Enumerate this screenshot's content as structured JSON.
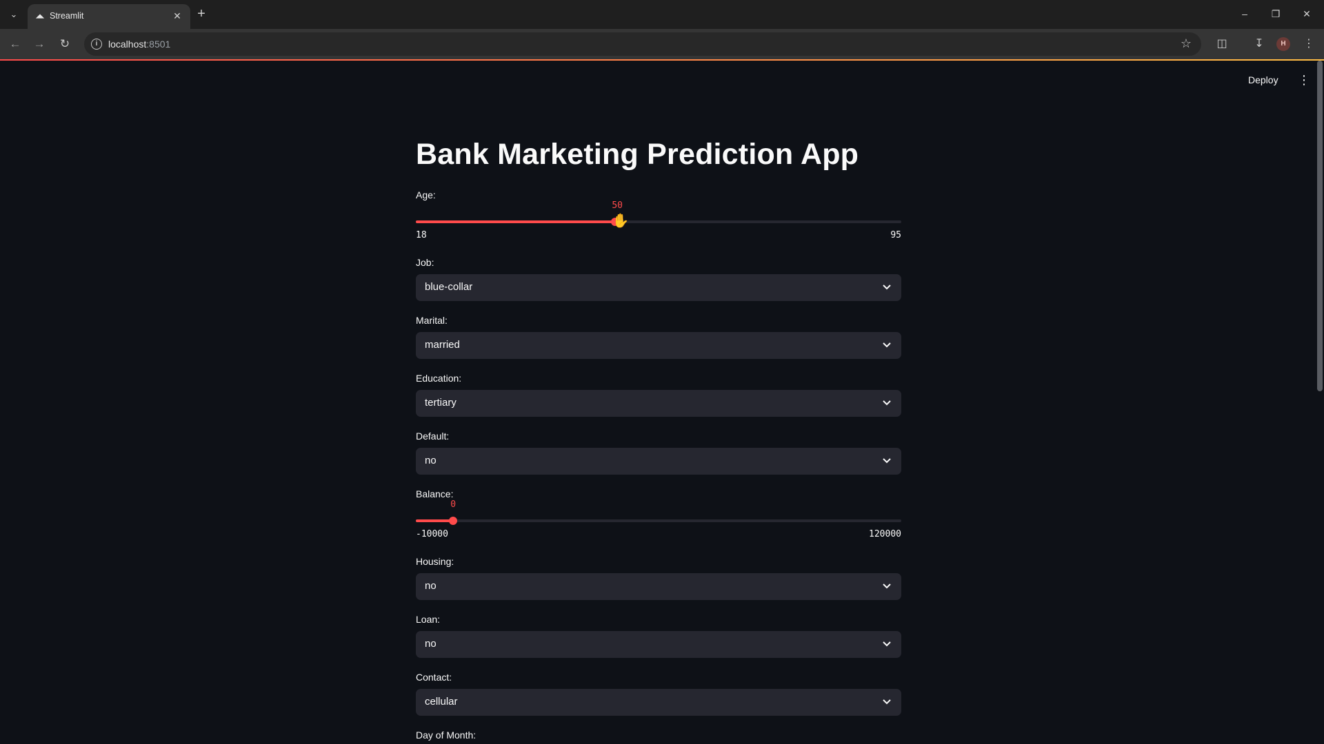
{
  "browser": {
    "tab_title": "Streamlit",
    "url_host": "localhost",
    "url_port": ":8501",
    "avatar_letter": "H"
  },
  "app": {
    "deploy_label": "Deploy",
    "title": "Bank Marketing Prediction App",
    "fields": {
      "age": {
        "label": "Age:",
        "value": "50",
        "min": "18",
        "max": "95"
      },
      "job": {
        "label": "Job:",
        "value": "blue-collar"
      },
      "marital": {
        "label": "Marital:",
        "value": "married"
      },
      "education": {
        "label": "Education:",
        "value": "tertiary"
      },
      "default": {
        "label": "Default:",
        "value": "no"
      },
      "balance": {
        "label": "Balance:",
        "value": "0",
        "min": "-10000",
        "max": "120000"
      },
      "housing": {
        "label": "Housing:",
        "value": "no"
      },
      "loan": {
        "label": "Loan:",
        "value": "no"
      },
      "contact": {
        "label": "Contact:",
        "value": "cellular"
      },
      "day_of_month": {
        "label": "Day of Month:"
      }
    }
  },
  "colors": {
    "accent": "#ff4b4b",
    "background": "#0e1117",
    "widget_bg": "#262730"
  }
}
